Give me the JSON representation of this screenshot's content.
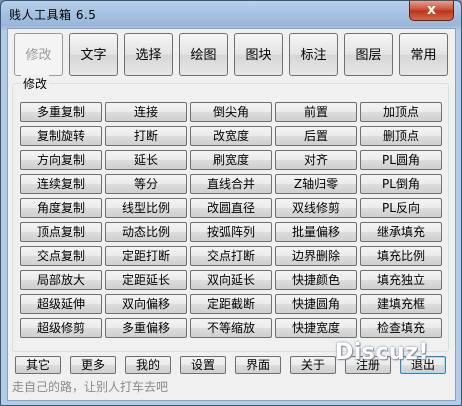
{
  "window": {
    "title": "贱人工具箱 6.5",
    "close_glyph": "x"
  },
  "tabs": [
    {
      "label": "修改",
      "active": true
    },
    {
      "label": "文字"
    },
    {
      "label": "选择"
    },
    {
      "label": "绘图"
    },
    {
      "label": "图块"
    },
    {
      "label": "标注"
    },
    {
      "label": "图层"
    },
    {
      "label": "常用"
    }
  ],
  "group": {
    "label": "修改",
    "rows": [
      [
        "多重复制",
        "连接",
        "倒尖角",
        "前置",
        "加顶点"
      ],
      [
        "复制旋转",
        "打断",
        "改宽度",
        "后置",
        "删顶点"
      ],
      [
        "方向复制",
        "延长",
        "刷宽度",
        "对齐",
        "PL圆角"
      ],
      [
        "连续复制",
        "等分",
        "直线合并",
        "Z轴归零",
        "PL倒角"
      ],
      [
        "角度复制",
        "线型比例",
        "改圆直径",
        "双线修剪",
        "PL反向"
      ],
      [
        "顶点复制",
        "动态比例",
        "按弧阵列",
        "批量偏移",
        "继承填充"
      ],
      [
        "交点复制",
        "定距打断",
        "交点打断",
        "边界删除",
        "填充比例"
      ],
      [
        "局部放大",
        "定距延长",
        "双向延长",
        "快捷颜色",
        "填充独立"
      ],
      [
        "超级延伸",
        "双向偏移",
        "定距截断",
        "快捷圆角",
        "建填充框"
      ],
      [
        "超级修剪",
        "多重偏移",
        "不等缩放",
        "快捷宽度",
        "检查填充"
      ]
    ]
  },
  "bottom_buttons": [
    "其它",
    "更多",
    "我的",
    "设置",
    "界面",
    "关于",
    "注册",
    "退出"
  ],
  "status": "走自己的路，让别人打车去吧",
  "watermark": "Discuz!"
}
